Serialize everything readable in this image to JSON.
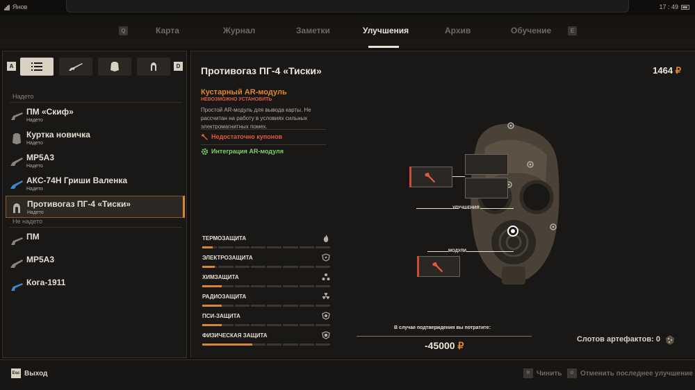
{
  "statusbar": {
    "carrier": "Янов",
    "time": "17 : 49"
  },
  "nav": {
    "left_key": "Q",
    "right_key": "E",
    "tabs": [
      {
        "label": "Карта",
        "active": false
      },
      {
        "label": "Журнал",
        "active": false
      },
      {
        "label": "Заметки",
        "active": false
      },
      {
        "label": "Улучшения",
        "active": true
      },
      {
        "label": "Архив",
        "active": false
      },
      {
        "label": "Обучение",
        "active": false
      }
    ]
  },
  "filters": {
    "left_key": "A",
    "right_key": "D",
    "buttons": [
      "list-icon",
      "rifle-icon",
      "armor-icon",
      "gasmask-icon"
    ],
    "active_index": 0
  },
  "inventory": {
    "equipped_header": "Надето",
    "unequipped_header": "Не надето",
    "equipped": [
      {
        "name": "ПМ «Скиф»",
        "status": "Надето",
        "icon": "pistol-icon"
      },
      {
        "name": "Куртка новичка",
        "status": "Надето",
        "icon": "armor-icon"
      },
      {
        "name": "MP5A3",
        "status": "Надето",
        "icon": "smg-icon"
      },
      {
        "name": "АКС-74Н Гриши Валенка",
        "status": "Надето",
        "icon": "rifle-icon"
      },
      {
        "name": "Противогаз ПГ-4 «Тиски»",
        "status": "Надето",
        "icon": "gasmask-icon"
      }
    ],
    "unequipped": [
      {
        "name": "ПМ",
        "icon": "pistol-icon"
      },
      {
        "name": "MP5A3",
        "icon": "smg-icon"
      },
      {
        "name": "Кога-1911",
        "icon": "pistol-icon"
      }
    ],
    "selected_index": 4
  },
  "detail": {
    "title": "Противогаз ПГ-4 «Тиски»",
    "money": "1464",
    "currency": "₽",
    "module": {
      "name": "Кустарный AR-модуль",
      "warning": "НЕВОЗМОЖНО УСТАНОВИТЬ",
      "description": "Простой AR-модуль для вывода карты. Не рассчитан на работу в условиях сильных электромагнитных помех.",
      "req_coupons": "Недостаточно купонов",
      "req_integration": "Интеграция AR-модуля"
    },
    "stats": [
      {
        "label": "ТЕРМОЗАЩИТА",
        "value": 0.08,
        "icon": "fire-icon"
      },
      {
        "label": "ЭЛЕКТРОЗАЩИТА",
        "value": 0.1,
        "icon": "electric-icon"
      },
      {
        "label": "ХИМЗАЩИТА",
        "value": 0.15,
        "icon": "chemical-icon"
      },
      {
        "label": "РАДИОЗАЩИТА",
        "value": 0.15,
        "icon": "radiation-icon"
      },
      {
        "label": "ПСИ-ЗАЩИТА",
        "value": 0.15,
        "icon": "psi-icon"
      },
      {
        "label": "ФИЗИЧЕСКАЯ ЗАЩИТА",
        "value": 0.39,
        "icon": "shield-icon"
      }
    ],
    "labels": {
      "upgrades": "УЛУЧШЕНИЯ",
      "modules": "МОДУЛИ"
    },
    "cost_label": "В случае подтверждения вы потратите:",
    "cost": "-45000",
    "artifacts": "Слотов артефактов: 0"
  },
  "footer": {
    "exit_key": "Esc",
    "exit": "Выход",
    "repair_key": "R",
    "repair": "Чинить",
    "undo_key": "G",
    "undo": "Отменить последнее улучшение"
  },
  "colors": {
    "accent": "#d9862f",
    "warning": "#e05a3e",
    "ok": "#7fd36a"
  }
}
